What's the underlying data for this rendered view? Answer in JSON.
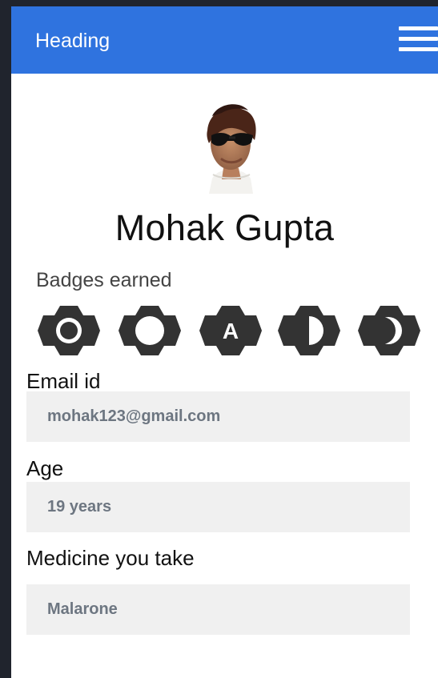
{
  "header": {
    "title": "Heading"
  },
  "profile": {
    "name": "Mohak Gupta"
  },
  "badges": {
    "label": "Badges earned",
    "items": [
      {
        "icon": "brightness-high-icon"
      },
      {
        "icon": "brightness-low-icon"
      },
      {
        "icon": "brightness-auto-icon",
        "glyph": "A"
      },
      {
        "icon": "brightness-medium-icon"
      },
      {
        "icon": "night-mode-icon"
      }
    ]
  },
  "fields": [
    {
      "label": "Email id",
      "value": "mohak123@gmail.com"
    },
    {
      "label": "Age",
      "value": "19 years"
    },
    {
      "label": "Medicine you take",
      "value": "Malarone"
    }
  ],
  "colors": {
    "appbar": "#2f73df",
    "input_background": "#f0f0f0",
    "input_text": "#6d7681",
    "badge": "#333333"
  }
}
